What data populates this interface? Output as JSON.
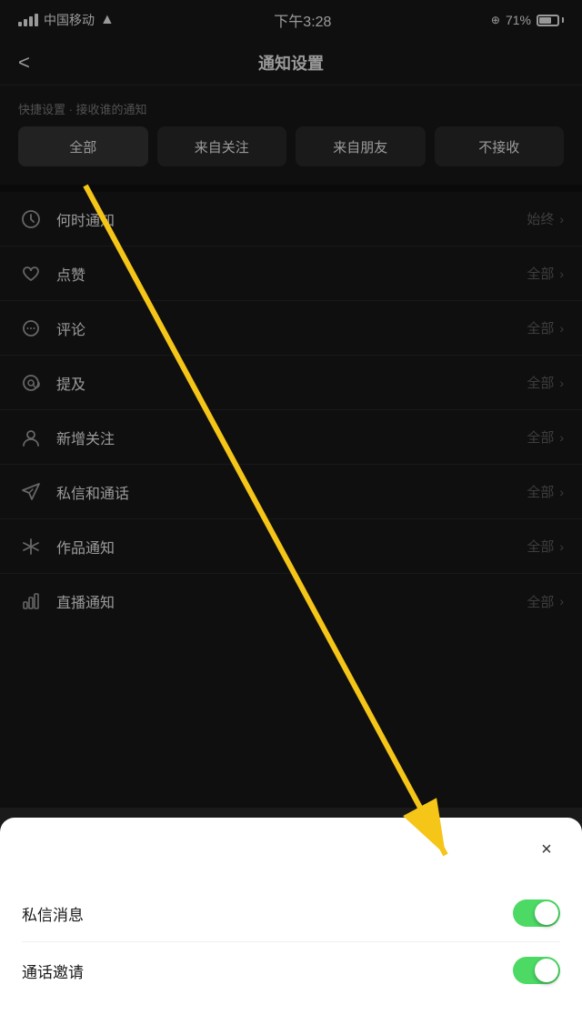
{
  "statusBar": {
    "carrier": "中国移动",
    "time": "下午3:28",
    "battery": "71%"
  },
  "nav": {
    "back": "<",
    "title": "通知设置"
  },
  "quickSettings": {
    "label": "快捷设置 · 接收谁的通知",
    "buttons": [
      {
        "id": "all",
        "label": "全部",
        "active": true
      },
      {
        "id": "following",
        "label": "来自关注",
        "active": false
      },
      {
        "id": "friends",
        "label": "来自朋友",
        "active": false
      },
      {
        "id": "none",
        "label": "不接收",
        "active": false
      }
    ]
  },
  "settingsItems": [
    {
      "id": "when",
      "icon": "clock",
      "label": "何时通知",
      "value": "始终"
    },
    {
      "id": "like",
      "icon": "heart",
      "label": "点赞",
      "value": "全部"
    },
    {
      "id": "comment",
      "icon": "comment",
      "label": "评论",
      "value": "全部"
    },
    {
      "id": "mention",
      "icon": "at",
      "label": "提及",
      "value": "全部"
    },
    {
      "id": "newfollower",
      "icon": "person",
      "label": "新增关注",
      "value": "全部"
    },
    {
      "id": "dm",
      "icon": "send",
      "label": "私信和通话",
      "value": "全部"
    },
    {
      "id": "work",
      "icon": "asterisk",
      "label": "作品通知",
      "value": "全部"
    },
    {
      "id": "live",
      "icon": "bar-chart",
      "label": "直播通知",
      "value": "全部"
    }
  ],
  "bottomSheet": {
    "closeLabel": "×",
    "items": [
      {
        "id": "dm-msg",
        "label": "私信消息",
        "enabled": true
      },
      {
        "id": "call-invite",
        "label": "通话邀请",
        "enabled": true
      }
    ]
  },
  "arrow": {
    "visible": true
  }
}
